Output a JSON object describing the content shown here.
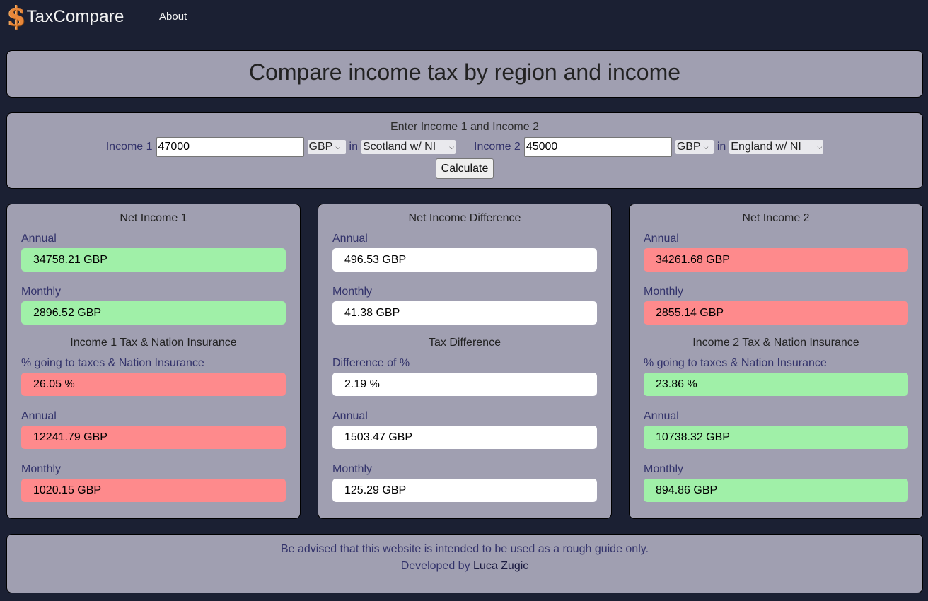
{
  "navbar": {
    "logo_icon": "dollar-sign-icon",
    "logo_glyph": "$",
    "brand": "TaxCompare",
    "links": [
      {
        "label": "About"
      }
    ]
  },
  "title": "Compare income tax by region and income",
  "form": {
    "heading": "Enter Income 1 and Income 2",
    "in_label": "in",
    "calculate_label": "Calculate",
    "income1": {
      "label": "Income 1",
      "value": "47000",
      "currency": "GBP",
      "region": "Scotland w/ NI"
    },
    "income2": {
      "label": "Income 2",
      "value": "45000",
      "currency": "GBP",
      "region": "England w/ NI"
    }
  },
  "colors": {
    "better": "#a0f0a8",
    "worse": "#fe8a8c",
    "neutral": "#ffffff"
  },
  "results": {
    "net1": {
      "title": "Net Income 1",
      "annual_label": "Annual",
      "annual": "34758.21 GBP",
      "monthly_label": "Monthly",
      "monthly": "2896.52 GBP",
      "tax_title": "Income 1 Tax & Nation Insurance",
      "pct_label": "% going to taxes & Nation Insurance",
      "pct": "26.05 %",
      "tax_annual_label": "Annual",
      "tax_annual": "12241.79 GBP",
      "tax_monthly_label": "Monthly",
      "tax_monthly": "1020.15 GBP"
    },
    "diff": {
      "title": "Net Income Difference",
      "annual_label": "Annual",
      "annual": "496.53 GBP",
      "monthly_label": "Monthly",
      "monthly": "41.38 GBP",
      "tax_title": "Tax Difference",
      "pct_label": "Difference of %",
      "pct": "2.19 %",
      "tax_annual_label": "Annual",
      "tax_annual": "1503.47 GBP",
      "tax_monthly_label": "Monthly",
      "tax_monthly": "125.29 GBP"
    },
    "net2": {
      "title": "Net Income 2",
      "annual_label": "Annual",
      "annual": "34261.68 GBP",
      "monthly_label": "Monthly",
      "monthly": "2855.14 GBP",
      "tax_title": "Income 2 Tax & Nation Insurance",
      "pct_label": "% going to taxes & Nation Insurance",
      "pct": "23.86 %",
      "tax_annual_label": "Annual",
      "tax_annual": "10738.32 GBP",
      "tax_monthly_label": "Monthly",
      "tax_monthly": "894.86 GBP"
    }
  },
  "footer": {
    "disclaimer": "Be advised that this website is intended to be used as a rough guide only.",
    "developed_by": "Developed by",
    "author": "Luca Zugic"
  }
}
